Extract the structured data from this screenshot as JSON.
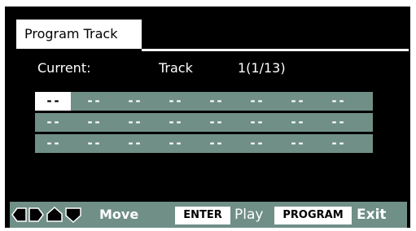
{
  "tab": {
    "label": "Program Track"
  },
  "status": {
    "current_label": "Current:",
    "track_label": "Track",
    "track_value": "1(1/13)"
  },
  "grid": {
    "rows": [
      [
        "--",
        "--",
        "--",
        "--",
        "--",
        "--",
        "--",
        "--"
      ],
      [
        "--",
        "--",
        "--",
        "--",
        "--",
        "--",
        "--",
        "--"
      ],
      [
        "--",
        "--",
        "--",
        "--",
        "--",
        "--",
        "--",
        "--"
      ]
    ],
    "selected": {
      "row": 0,
      "col": 0
    }
  },
  "bottom_bar": {
    "arrow_icons": [
      "left-arrow-icon",
      "right-arrow-icon",
      "up-arrow-icon",
      "down-arrow-icon"
    ],
    "move_label": "Move",
    "enter_key": "ENTER",
    "play_label": "Play",
    "program_key": "PROGRAM",
    "exit_label": "Exit"
  },
  "colors": {
    "background": "#000000",
    "bar": "#6f8f87",
    "highlight": "#ffffff"
  }
}
